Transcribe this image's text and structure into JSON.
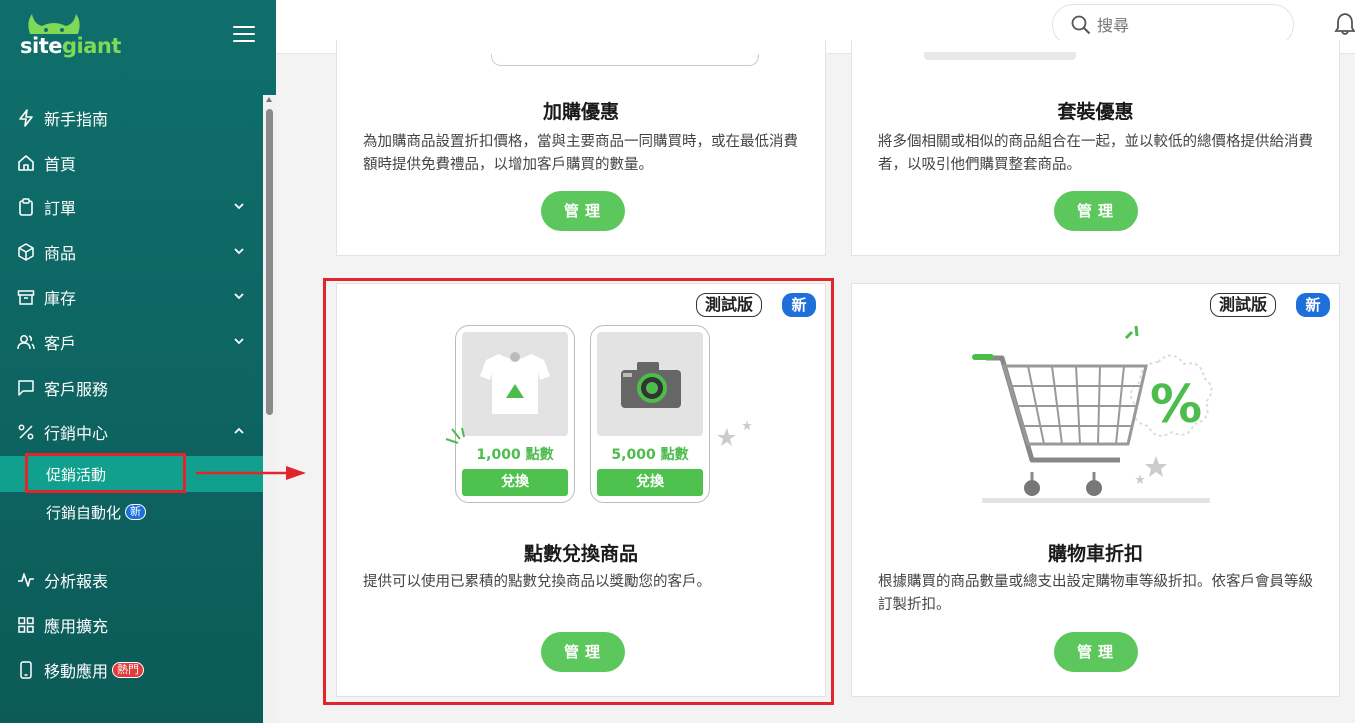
{
  "brand": {
    "logo_part1": "site",
    "logo_part2": "giant"
  },
  "sidebar": {
    "items": [
      {
        "label": "新手指南",
        "icon": "bolt-icon"
      },
      {
        "label": "首頁",
        "icon": "home-icon"
      },
      {
        "label": "訂單",
        "icon": "clipboard-icon"
      },
      {
        "label": "商品",
        "icon": "box-icon"
      },
      {
        "label": "庫存",
        "icon": "archive-icon"
      },
      {
        "label": "客戶",
        "icon": "users-icon"
      },
      {
        "label": "客戶服務",
        "icon": "chat-icon"
      },
      {
        "label": "行銷中心",
        "icon": "percent-icon"
      },
      {
        "label": "分析報表",
        "icon": "pulse-icon"
      },
      {
        "label": "應用擴充",
        "icon": "grid-icon"
      },
      {
        "label": "移動應用",
        "icon": "phone-icon"
      }
    ],
    "sub_items": [
      {
        "label": "促銷活動"
      },
      {
        "label": "行銷自動化"
      }
    ],
    "badge_new": "新",
    "badge_hot": "熱門"
  },
  "topbar": {
    "search_placeholder": "搜尋"
  },
  "cards": {
    "addon": {
      "title": "加購優惠",
      "desc": "為加購商品設置折扣價格，當與主要商品一同購買時，或在最低消費額時提供免費禮品，以增加客戶購買的數量。",
      "button": "管理"
    },
    "bundle": {
      "title": "套裝優惠",
      "desc": "將多個相關或相似的商品組合在一起，並以較低的總價格提供給消費者，以吸引他們購買整套商品。",
      "button": "管理"
    },
    "points": {
      "title": "點數兌換商品",
      "desc": "提供可以使用已累積的點數兌換商品以獎勵您的客戶。",
      "button": "管理",
      "beta": "測試版",
      "new": "新",
      "products": [
        {
          "points": "1,000 點數",
          "redeem": "兌換"
        },
        {
          "points": "5,000 點數",
          "redeem": "兌換"
        }
      ]
    },
    "cart": {
      "title": "購物車折扣",
      "desc": "根據購買的商品數量或總支出設定購物車等級折扣。依客戶會員等級訂製折扣。",
      "button": "管理",
      "beta": "測試版",
      "new": "新"
    }
  },
  "colors": {
    "sidebar": "#0f6f6c",
    "accent_green": "#5cc75c",
    "highlight": "#e0262c",
    "new_blue": "#1e6fd9"
  }
}
